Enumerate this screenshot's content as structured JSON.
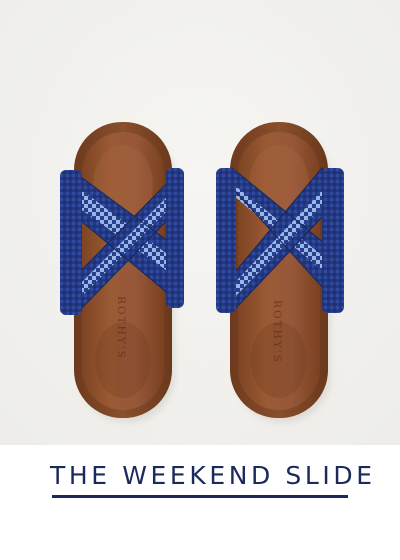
{
  "product": {
    "title": "THE WEEKEND SLIDE",
    "brand_imprint": "ROTHY'S"
  },
  "photo": {
    "subject_icon": "sandal-pair-icon",
    "colors": {
      "background": "#f2f1ee",
      "footbed": "#8a4f2c",
      "strap_navy": "#233778",
      "strap_blue": "#2f4fa4",
      "stripe_light": "#8fb2ea"
    }
  },
  "caption": {
    "color": "#1b2a5c"
  }
}
